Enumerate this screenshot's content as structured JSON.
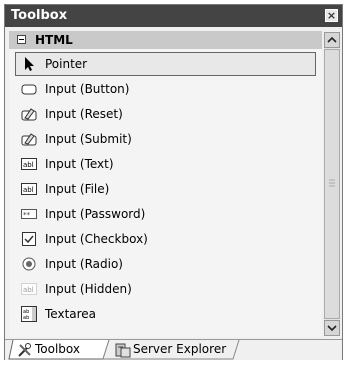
{
  "window": {
    "title": "Toolbox"
  },
  "category": {
    "label": "HTML"
  },
  "items": [
    {
      "label": "Pointer",
      "icon": "pointer-icon"
    },
    {
      "label": "Input (Button)",
      "icon": "button-icon"
    },
    {
      "label": "Input (Reset)",
      "icon": "reset-icon"
    },
    {
      "label": "Input (Submit)",
      "icon": "submit-icon"
    },
    {
      "label": "Input (Text)",
      "icon": "textbox-icon"
    },
    {
      "label": "Input (File)",
      "icon": "file-input-icon"
    },
    {
      "label": "Input (Password)",
      "icon": "password-icon"
    },
    {
      "label": "Input (Checkbox)",
      "icon": "checkbox-icon"
    },
    {
      "label": "Input (Radio)",
      "icon": "radio-icon"
    },
    {
      "label": "Input (Hidden)",
      "icon": "hidden-input-icon"
    },
    {
      "label": "Textarea",
      "icon": "textarea-icon"
    }
  ],
  "tabs": [
    {
      "label": "Toolbox",
      "icon": "tools-icon"
    },
    {
      "label": "Server Explorer",
      "icon": "server-icon"
    }
  ]
}
